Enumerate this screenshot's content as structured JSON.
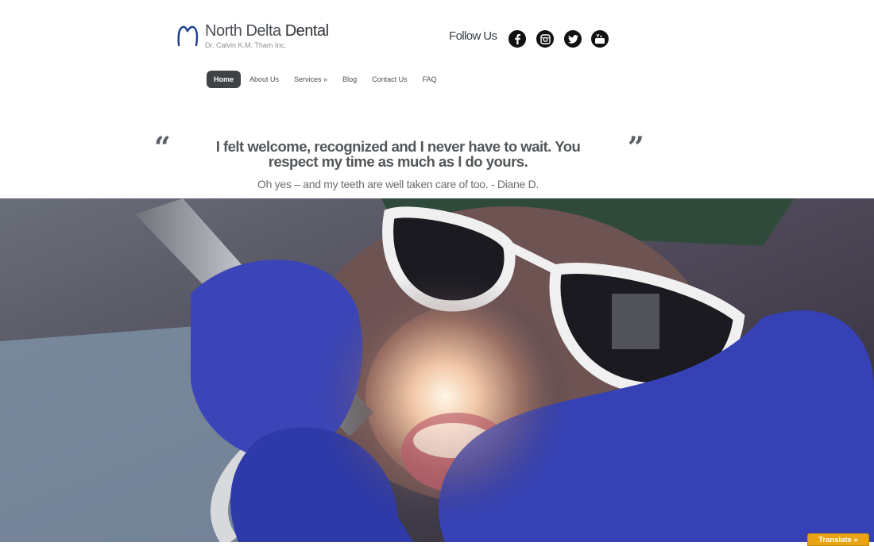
{
  "brand": {
    "name_light": "North Delta",
    "name_bold": "Dental",
    "subtitle": "Dr. Calvin K.M. Tham Inc."
  },
  "social": {
    "label": "Follow Us",
    "icons": [
      "facebook-icon",
      "instagram-icon",
      "twitter-icon",
      "youtube-icon"
    ]
  },
  "nav": {
    "items": [
      {
        "label": "Home",
        "active": true
      },
      {
        "label": "About Us"
      },
      {
        "label": "Services »"
      },
      {
        "label": "Blog"
      },
      {
        "label": "Contact Us"
      },
      {
        "label": "FAQ"
      }
    ]
  },
  "testimonial": {
    "quote": "I felt welcome, recognized and I never have to wait. You respect my time as much as I do yours.",
    "attribution": "Oh yes – and my teeth are well taken care of too. - Diane D.",
    "open_mark": "“",
    "close_mark": "”"
  },
  "translate": {
    "label": "Translate »"
  },
  "colors": {
    "accent": "#1a3f8f",
    "nav_active": "#3e4347",
    "translate": "#e8a317"
  }
}
